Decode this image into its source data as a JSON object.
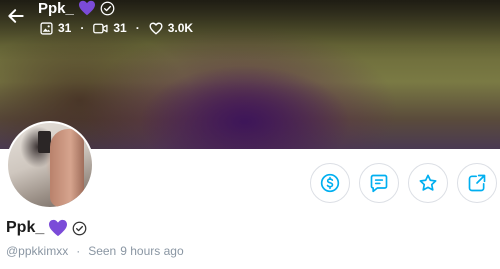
{
  "header": {
    "name": "Ppk_",
    "stats": {
      "photos": "31",
      "videos": "31",
      "likes": "3.0K"
    },
    "separator": "·"
  },
  "profile": {
    "name": "Ppk_",
    "username": "@ppkkimxx",
    "separator": "·",
    "seen_label": "Seen",
    "seen_time": "9 hours ago"
  },
  "icons": {
    "back": "arrow-left-icon",
    "heart_badge": "purple-heart-icon",
    "verified": "verified-icon",
    "photos": "image-icon",
    "videos": "video-icon",
    "likes": "heart-outline-icon",
    "tip": "dollar-icon",
    "message": "message-icon",
    "favorite": "star-icon",
    "share": "share-icon"
  },
  "colors": {
    "accent": "#00aff0",
    "heart": "#7b4bd8",
    "muted_text": "#8a96a3"
  }
}
